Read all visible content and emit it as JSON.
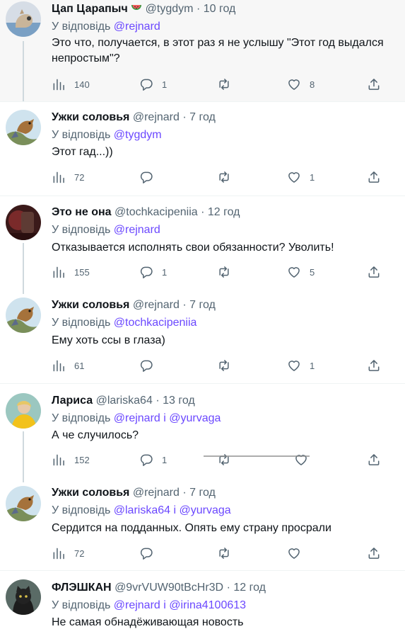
{
  "colors": {
    "mention": "#6b48ff",
    "muted": "#536471",
    "text": "#0f1419",
    "highlight_bg": "#f7f7f7",
    "thread_line": "#cfd9de"
  },
  "reply_prefix": "У відповідь",
  "tweets": [
    {
      "name": "Цап Царапыч",
      "name_emoji": "watermelon-icon",
      "handle": "@tygdym",
      "dot": "·",
      "time": "10 год",
      "reply_to_1": "@rejnard",
      "joiner": "",
      "reply_to_2": "",
      "text": "Это что, получается, в этот раз я не услышу \"Этот год выдался непростым\"?",
      "views": "140",
      "replies": "1",
      "retweets": "",
      "likes": "8"
    },
    {
      "name": "Ужки соловья",
      "handle": "@rejnard",
      "dot": "·",
      "time": "7 год",
      "reply_to_1": "@tygdym",
      "joiner": "",
      "reply_to_2": "",
      "text": "Этот гад...))",
      "views": "72",
      "replies": "",
      "retweets": "",
      "likes": "1"
    },
    {
      "name": "Это не она",
      "handle": "@tochkacipeniia",
      "dot": "·",
      "time": "12 год",
      "reply_to_1": "@rejnard",
      "joiner": "",
      "reply_to_2": "",
      "text": "Отказывается исполнять свои обязанности? Уволить!",
      "views": "155",
      "replies": "1",
      "retweets": "",
      "likes": "5"
    },
    {
      "name": "Ужки соловья",
      "handle": "@rejnard",
      "dot": "·",
      "time": "7 год",
      "reply_to_1": "@tochkacipeniia",
      "joiner": "",
      "reply_to_2": "",
      "text": "Ему хоть ссы в глаза)",
      "views": "61",
      "replies": "",
      "retweets": "",
      "likes": "1"
    },
    {
      "name": "Лариса",
      "handle": "@lariska64",
      "dot": "·",
      "time": "13 год",
      "reply_to_1": "@rejnard",
      "joiner": "і",
      "reply_to_2": "@yurvaga",
      "text": "А че случилось?",
      "views": "152",
      "replies": "1",
      "retweets": "",
      "likes": ""
    },
    {
      "name": "Ужки соловья",
      "handle": "@rejnard",
      "dot": "·",
      "time": "7 год",
      "reply_to_1": "@lariska64",
      "joiner": "і",
      "reply_to_2": "@yurvaga",
      "text": "Сердится на подданных. Опять ему страну просрали",
      "views": "72",
      "replies": "",
      "retweets": "",
      "likes": ""
    },
    {
      "name": "ФЛЭШКАН",
      "handle": "@9vrVUW90tBcHr3D",
      "dot": "·",
      "time": "12 год",
      "reply_to_1": "@rejnard",
      "joiner": "і",
      "reply_to_2": "@irina4100613",
      "text": "Не самая обнадёживающая новость",
      "views": "",
      "replies": "",
      "retweets": "",
      "likes": ""
    }
  ]
}
